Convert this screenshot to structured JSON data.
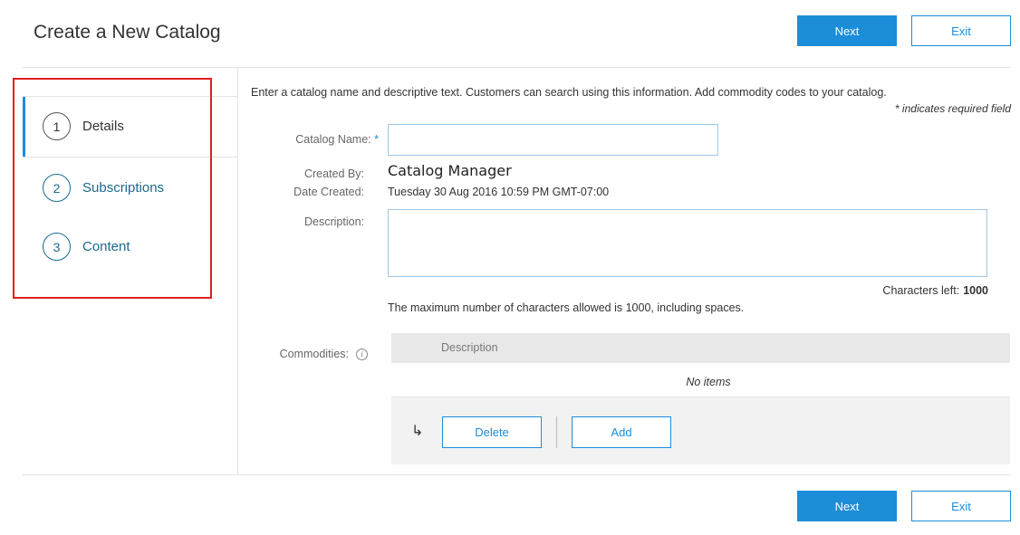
{
  "header": {
    "title": "Create a New Catalog",
    "next_label": "Next",
    "exit_label": "Exit"
  },
  "steps": [
    {
      "number": "1",
      "label": "Details",
      "state": "current"
    },
    {
      "number": "2",
      "label": "Subscriptions",
      "state": "link"
    },
    {
      "number": "3",
      "label": "Content",
      "state": "link"
    }
  ],
  "form": {
    "intro": "Enter a catalog name and descriptive text. Customers can search using this information. Add commodity codes to your catalog.",
    "required_note": "* indicates required field",
    "catalog_name_label": "Catalog Name:",
    "required_star": "*",
    "catalog_name_value": "",
    "created_by_label": "Created By:",
    "created_by_value": "Catalog Manager",
    "date_created_label": "Date Created:",
    "date_created_value": "Tuesday 30 Aug 2016 10:59 PM GMT-07:00",
    "description_label": "Description:",
    "description_value": "",
    "chars_left_label": "Characters left:",
    "chars_left_value": "1000",
    "max_note": "The maximum number of characters allowed is 1000, including spaces."
  },
  "commodities": {
    "label": "Commodities:",
    "info_icon": "info-icon",
    "column_description": "Description",
    "empty_text": "No items",
    "delete_label": "Delete",
    "add_label": "Add"
  },
  "footer": {
    "next_label": "Next",
    "exit_label": "Exit"
  },
  "colors": {
    "accent": "#1c8ed9",
    "step_link": "#1a6a8f",
    "highlight": "#e02020"
  }
}
